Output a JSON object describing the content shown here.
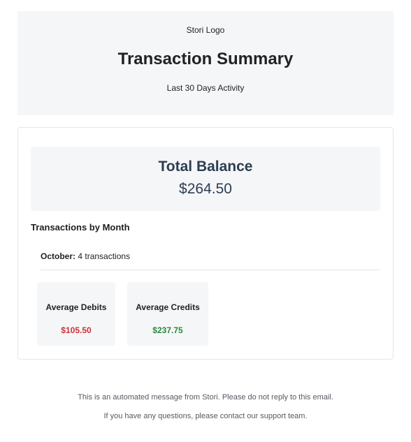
{
  "header": {
    "logo_text": "Stori Logo",
    "title": "Transaction Summary",
    "subtitle": "Last 30 Days Activity"
  },
  "balance": {
    "label": "Total Balance",
    "amount": "$264.50"
  },
  "transactions_by_month": {
    "title": "Transactions by Month",
    "months": [
      {
        "month": "October:",
        "count_text": "4 transactions"
      }
    ]
  },
  "averages": {
    "debits": {
      "label": "Average Debits",
      "value": "$105.50",
      "color": "#d0313b"
    },
    "credits": {
      "label": "Average Credits",
      "value": "$237.75",
      "color": "#2a8a3e"
    }
  },
  "footer": {
    "line1": "This is an automated message from Stori. Please do not reply to this email.",
    "line2": "If you have any questions, please contact our support team."
  }
}
